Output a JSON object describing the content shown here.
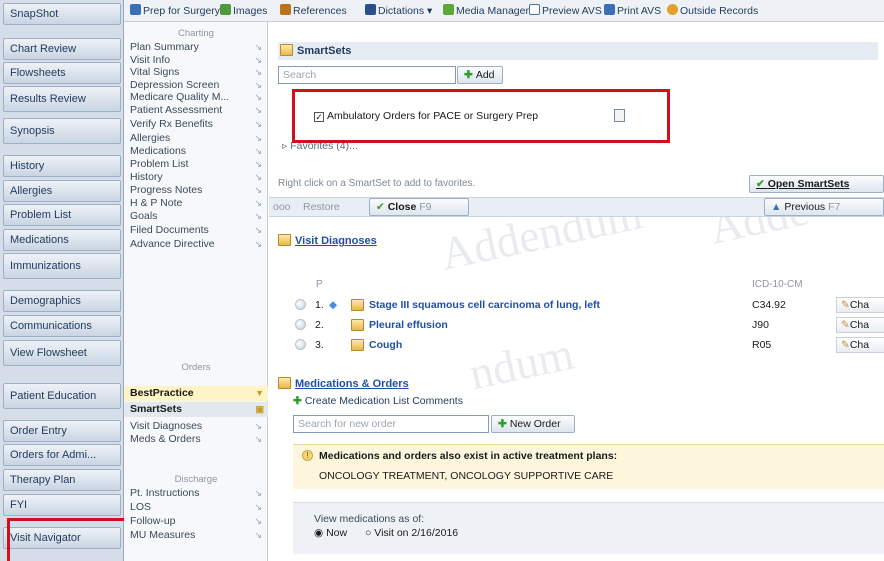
{
  "left_nav": {
    "items": [
      "SnapShot",
      "Chart Review",
      "Flowsheets",
      "Results Review",
      "Synopsis",
      "History",
      "Allergies",
      "Problem List",
      "Medications",
      "Immunizations",
      "Demographics",
      "Communications",
      "View Flowsheet",
      "Patient Education",
      "Order Entry",
      "Orders for Admi...",
      "Therapy Plan",
      "FYI",
      "Visit Navigator"
    ]
  },
  "toolbar": {
    "items": [
      "Prep for Surgery",
      "Images",
      "References",
      "Dictations",
      "Media Manager",
      "Preview AVS",
      "Print AVS",
      "Outside Records"
    ],
    "dictations_arrow": "▾"
  },
  "submenu": {
    "charting_header": "Charting",
    "charting": [
      "Plan Summary",
      "Visit Info",
      "Vital Signs",
      "Depression Screen",
      "Medicare Quality M...",
      "Patient Assessment",
      "Verify Rx Benefits",
      "Allergies",
      "Medications",
      "Problem List",
      "History",
      "Progress Notes",
      "H & P Note",
      "Goals",
      "Filed Documents",
      "Advance Directive"
    ],
    "orders_header": "Orders",
    "orders": [
      "BestPractice",
      "SmartSets",
      "Visit Diagnoses",
      "Meds & Orders"
    ],
    "discharge_header": "Discharge",
    "discharge": [
      "Pt. Instructions",
      "LOS",
      "Follow-up",
      "MU Measures"
    ]
  },
  "smartsets": {
    "title": "SmartSets",
    "search_placeholder": "Search",
    "add_label": "Add",
    "checkbox_label": "Ambulatory Orders for PACE or Surgery Prep",
    "checkbox_checked": true,
    "favorites": "Favorites (4)...",
    "hint": "Right click on a SmartSet to add to favorites.",
    "open_label": "Open SmartSets",
    "restore_label": "Restore",
    "close_label": "Close",
    "close_key": "F9",
    "previous_label": "Previous",
    "previous_key": "F7",
    "left_stub": "ooo"
  },
  "visit_diagnoses": {
    "title": "Visit Diagnoses",
    "col_p": "P",
    "col_code": "ICD-10-CM",
    "rows": [
      {
        "num": "1.",
        "name": "Stage III squamous cell carcinoma of lung, left",
        "code": "C34.92",
        "action": "Cha"
      },
      {
        "num": "2.",
        "name": "Pleural effusion",
        "code": "J90",
        "action": "Cha"
      },
      {
        "num": "3.",
        "name": "Cough",
        "code": "R05",
        "action": "Cha"
      }
    ]
  },
  "meds_orders": {
    "title": "Medications & Orders",
    "create_comments": "Create Medication List Comments",
    "search_placeholder": "Search for new order",
    "new_order_label": "New Order",
    "alert_text": "Medications and orders also exist in active treatment plans:",
    "plans": "ONCOLOGY TREATMENT, ONCOLOGY SUPPORTIVE CARE",
    "view_as_of": "View medications as of:",
    "radio_now": "Now",
    "radio_visit": "Visit on 2/16/2016"
  },
  "colors": {
    "red_highlight": "#d0101a",
    "nav_bg": "#d4dde8",
    "link_blue": "#1f4fa8"
  }
}
